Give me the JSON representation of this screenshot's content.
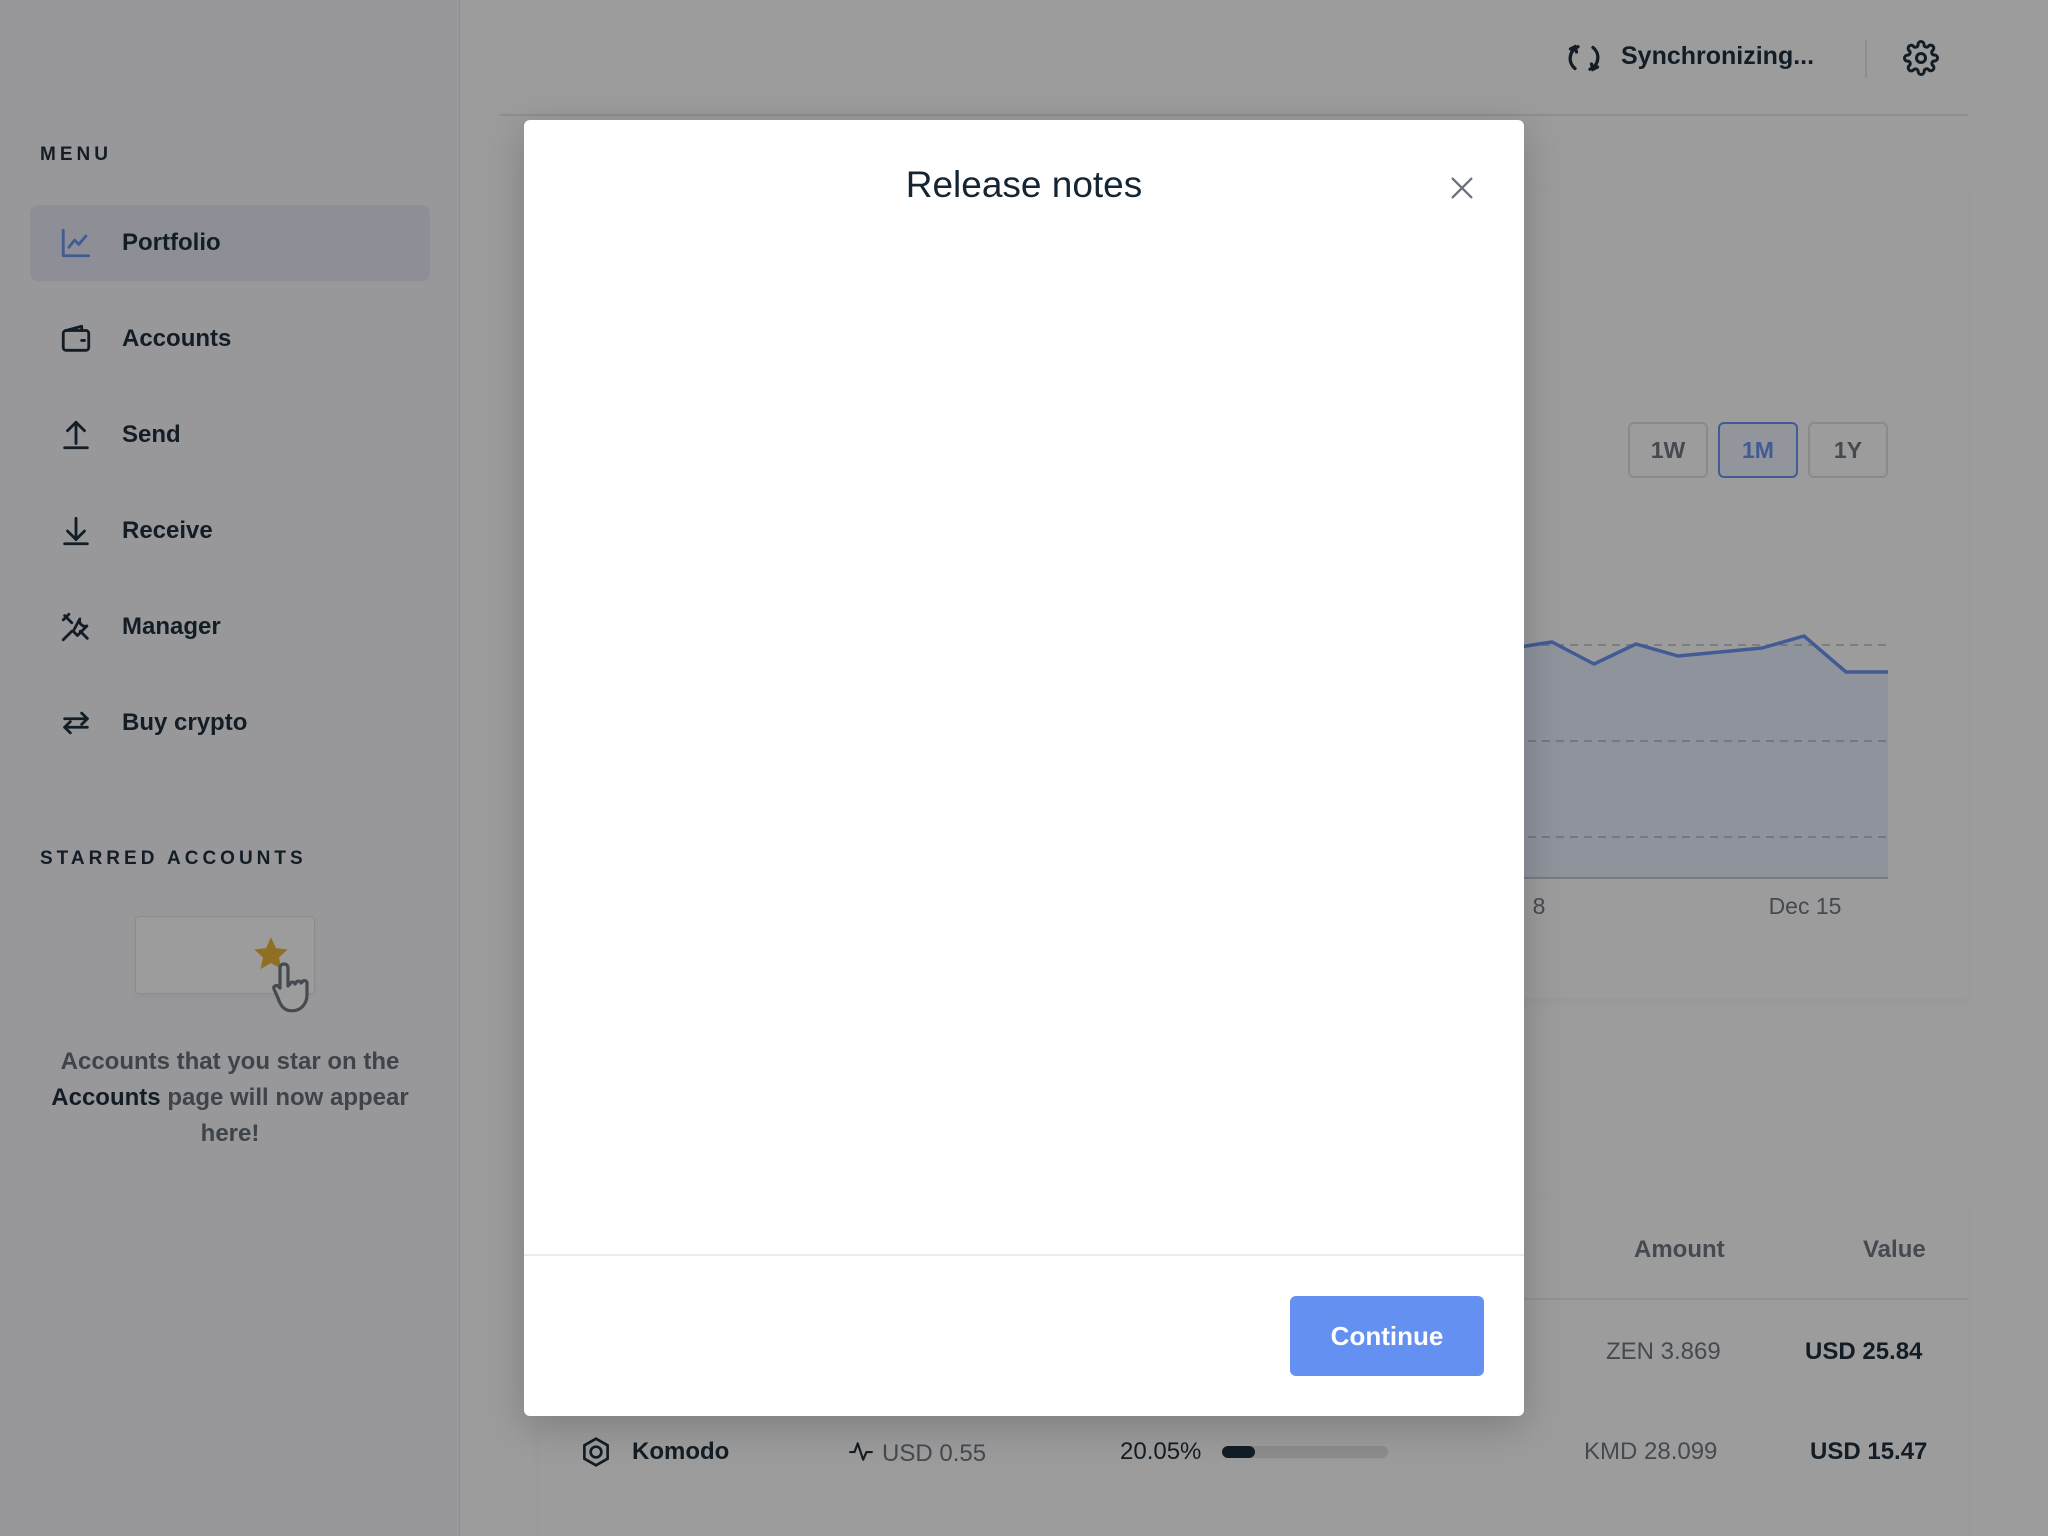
{
  "sidebar": {
    "menu_title": "MENU",
    "items": [
      {
        "label": "Portfolio",
        "icon": "chart-line-icon",
        "active": true
      },
      {
        "label": "Accounts",
        "icon": "wallet-icon",
        "active": false
      },
      {
        "label": "Send",
        "icon": "arrow-up-icon",
        "active": false
      },
      {
        "label": "Receive",
        "icon": "arrow-down-icon",
        "active": false
      },
      {
        "label": "Manager",
        "icon": "tools-icon",
        "active": false
      },
      {
        "label": "Buy crypto",
        "icon": "exchange-icon",
        "active": false
      }
    ],
    "starred_title": "STARRED ACCOUNTS",
    "starred_text_1": "Accounts that you star on the",
    "starred_text_bold": "Accounts",
    "starred_text_2": "page will now appear here!"
  },
  "topbar": {
    "sync_status": "Synchronizing..."
  },
  "chart": {
    "range_buttons": [
      "1W",
      "1M",
      "1Y"
    ],
    "selected_range": "1M",
    "accent_color": "#6490f1"
  },
  "chart_data": {
    "type": "area",
    "x_tick_labels": [
      "8",
      "Dec 15"
    ],
    "grid": true
  },
  "table": {
    "headers": {
      "amount": "Amount",
      "value": "Value"
    },
    "rows": [
      {
        "name": "",
        "price": "",
        "allocation": "",
        "amount": "ZEN 3.869",
        "value": "USD 25.84"
      },
      {
        "name": "Komodo",
        "price": "USD 0.55",
        "allocation": "20.05%",
        "allocation_fraction": 0.2005,
        "amount": "KMD 28.099",
        "value": "USD 15.47"
      }
    ]
  },
  "modal": {
    "title": "Release notes",
    "continue_label": "Continue",
    "button_color": "#6490f1"
  }
}
